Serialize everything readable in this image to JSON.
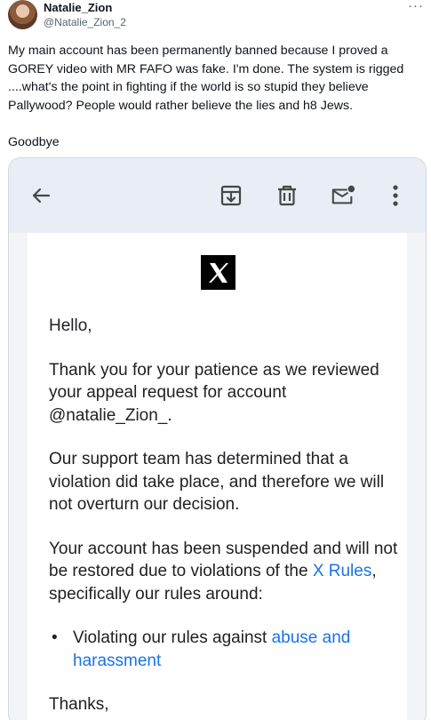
{
  "tweet": {
    "display_name": "Natalie_Zion",
    "handle": "@Natalie_Zion_2",
    "more_icon": "more-horizontal-icon",
    "text_lines": [
      "My main account has been permanently banned because I proved a",
      "GOREY video with MR FAFO was fake. I'm done. The system is rigged",
      "....what's the point in fighting if the world is so stupid they believe",
      "Pallywood? People would rather believe the lies and h8 Jews."
    ],
    "signoff": "Goodbye"
  },
  "email_toolbar": {
    "icons": [
      "back-arrow-icon",
      "archive-icon",
      "delete-icon",
      "mark-unread-icon",
      "more-vertical-icon"
    ]
  },
  "email": {
    "logo_letter": "X",
    "greeting": "Hello,",
    "para1": "Thank you for your patience as we reviewed your appeal request for account @natalie_Zion_.",
    "para2": "Our support team has determined that a violation did take place, and therefore we will not overturn our decision.",
    "para3_pre": "Your account has been suspended and will not be restored due to violations of the ",
    "para3_link": "X Rules",
    "para3_post": ", specifically our rules around:",
    "bullet_dot": "•",
    "bullet_pre": "Violating our rules against ",
    "bullet_link": "abuse and harassment",
    "closing": "Thanks,",
    "link_color": "#1a73e8"
  }
}
